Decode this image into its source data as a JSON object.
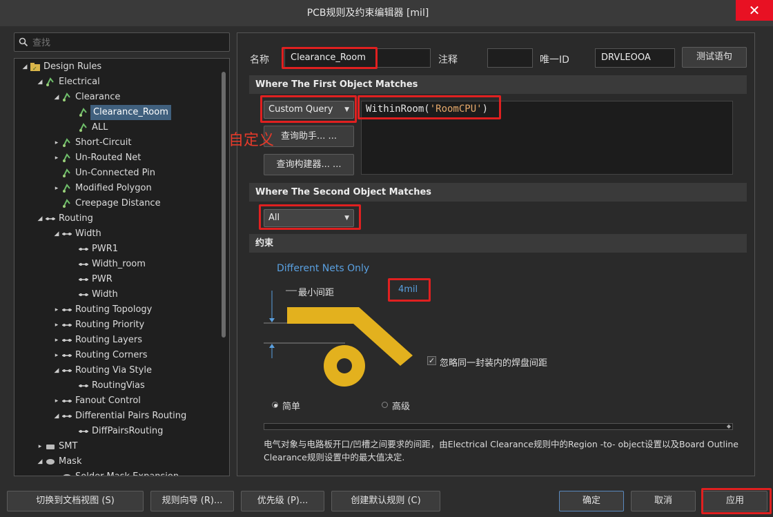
{
  "window": {
    "title": "PCB规则及约束编辑器 [mil]",
    "close_label": "✕"
  },
  "search": {
    "placeholder": "查找"
  },
  "tree": [
    {
      "label": "Design Rules",
      "level": 0,
      "arrow": "◢",
      "icon": "folder-rules-icon"
    },
    {
      "label": "Electrical",
      "level": 1,
      "arrow": "◢",
      "icon": "rule-icon"
    },
    {
      "label": "Clearance",
      "level": 2,
      "arrow": "◢",
      "icon": "rule-icon"
    },
    {
      "label": "Clearance_Room",
      "level": 3,
      "arrow": "",
      "icon": "rule-icon",
      "selected": true
    },
    {
      "label": "ALL",
      "level": 3,
      "arrow": "",
      "icon": "rule-icon"
    },
    {
      "label": "Short-Circuit",
      "level": 2,
      "arrow": "▸",
      "icon": "rule-icon"
    },
    {
      "label": "Un-Routed Net",
      "level": 2,
      "arrow": "▸",
      "icon": "rule-icon"
    },
    {
      "label": "Un-Connected Pin",
      "level": 2,
      "arrow": "",
      "icon": "rule-icon"
    },
    {
      "label": "Modified Polygon",
      "level": 2,
      "arrow": "▸",
      "icon": "rule-icon"
    },
    {
      "label": "Creepage Distance",
      "level": 2,
      "arrow": "",
      "icon": "rule-icon"
    },
    {
      "label": "Routing",
      "level": 1,
      "arrow": "◢",
      "icon": "routing-icon"
    },
    {
      "label": "Width",
      "level": 2,
      "arrow": "◢",
      "icon": "routing-icon"
    },
    {
      "label": "PWR1",
      "level": 3,
      "arrow": "",
      "icon": "routing-icon"
    },
    {
      "label": "Width_room",
      "level": 3,
      "arrow": "",
      "icon": "routing-icon"
    },
    {
      "label": "PWR",
      "level": 3,
      "arrow": "",
      "icon": "routing-icon"
    },
    {
      "label": "Width",
      "level": 3,
      "arrow": "",
      "icon": "routing-icon"
    },
    {
      "label": "Routing Topology",
      "level": 2,
      "arrow": "▸",
      "icon": "routing-icon"
    },
    {
      "label": "Routing Priority",
      "level": 2,
      "arrow": "▸",
      "icon": "routing-icon"
    },
    {
      "label": "Routing Layers",
      "level": 2,
      "arrow": "▸",
      "icon": "routing-icon"
    },
    {
      "label": "Routing Corners",
      "level": 2,
      "arrow": "▸",
      "icon": "routing-icon"
    },
    {
      "label": "Routing Via Style",
      "level": 2,
      "arrow": "◢",
      "icon": "routing-icon"
    },
    {
      "label": "RoutingVias",
      "level": 3,
      "arrow": "",
      "icon": "routing-icon"
    },
    {
      "label": "Fanout Control",
      "level": 2,
      "arrow": "▸",
      "icon": "routing-icon"
    },
    {
      "label": "Differential Pairs Routing",
      "level": 2,
      "arrow": "◢",
      "icon": "routing-icon"
    },
    {
      "label": "DiffPairsRouting",
      "level": 3,
      "arrow": "",
      "icon": "routing-icon"
    },
    {
      "label": "SMT",
      "level": 1,
      "arrow": "▸",
      "icon": "smt-icon"
    },
    {
      "label": "Mask",
      "level": 1,
      "arrow": "◢",
      "icon": "mask-icon"
    },
    {
      "label": "Solder Mask Expansion",
      "level": 2,
      "arrow": "",
      "icon": "mask-icon"
    }
  ],
  "rule": {
    "name_label": "名称",
    "name_value": "Clearance_Room",
    "comment_label": "注释",
    "comment_value": "",
    "uid_label": "唯一ID",
    "uid_value": "DRVLEOOA",
    "test_button": "测试语句"
  },
  "first_match": {
    "header": "Where The First Object Matches",
    "combo": "Custom Query",
    "helper_button": "查询助手... ...",
    "builder_button": "查询构建器... ...",
    "query_prefix": "WithinRoom(",
    "query_string": "'RoomCPU'",
    "query_suffix": ")",
    "annotation": "自定义"
  },
  "second_match": {
    "header": "Where The Second Object Matches",
    "combo": "All"
  },
  "constraints": {
    "header": "约束",
    "nets_mode": "Different Nets Only",
    "min_clearance_label": "最小间距",
    "min_clearance_value": "4mil",
    "ignore_pads_label": "忽略同一封装内的焊盘间距",
    "ignore_pads_checked": true,
    "simple_label": "简单",
    "advanced_label": "高级",
    "mode": "simple",
    "description": "电气对象与电路板开口/凹槽之间要求的间距，由Electrical Clearance规则中的Region -to- object设置以及Board Outline Clearance规则设置中的最大值决定."
  },
  "colors": {
    "copper": "#e3b11e",
    "accent": "#5aa0e0",
    "highlight": "#e02020"
  },
  "footer": {
    "doc_view": "切换到文档视图 (S)",
    "wizard": "规则向导 (R)...",
    "priority": "优先级 (P)...",
    "create_default": "创建默认规则 (C)",
    "ok": "确定",
    "cancel": "取消",
    "apply": "应用"
  }
}
